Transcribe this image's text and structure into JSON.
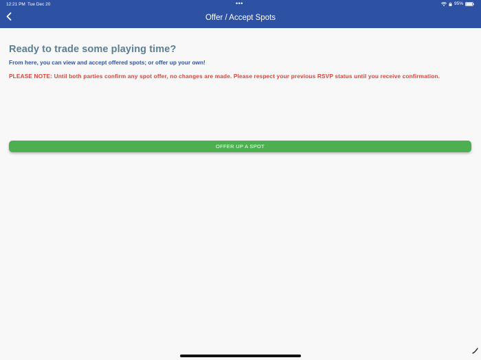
{
  "status_bar": {
    "time": "12:21 PM",
    "date": "Tue Dec 20",
    "dots": "•••",
    "battery": "95%"
  },
  "nav": {
    "title": "Offer / Accept Spots",
    "back_icon": "chevron-left-icon"
  },
  "main": {
    "headline": "Ready to trade some playing time?",
    "subline": "From here, you can view and accept offered spots; or offer up your own!",
    "notice": "PLEASE NOTE: Until both parties confirm any spot offer, no changes are made. Please respect your previous RSVP status until you receive confirmation."
  },
  "actions": {
    "offer_label": "OFFER UP A SPOT"
  },
  "colors": {
    "header": "#2e52a3",
    "headline": "#5b7f92",
    "subline": "#2d55a4",
    "notice": "#d9443a",
    "button": "#4caf50"
  }
}
